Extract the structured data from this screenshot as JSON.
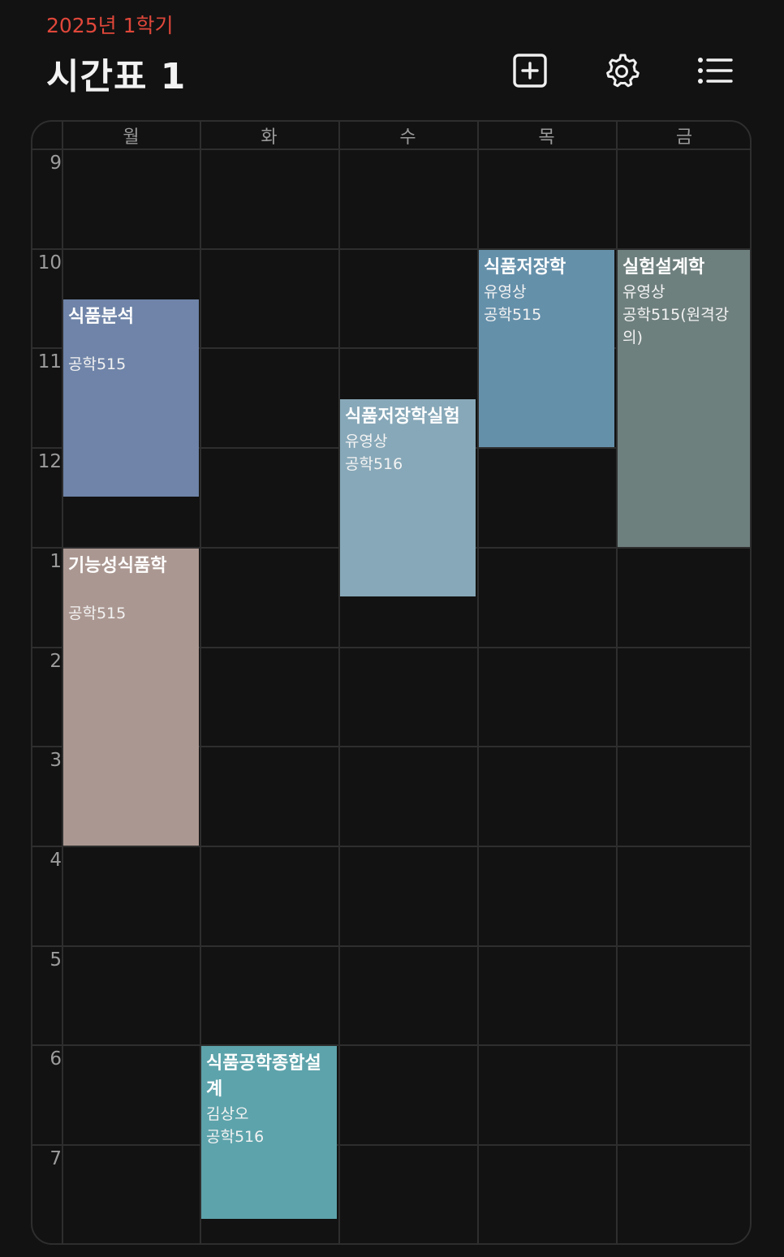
{
  "header": {
    "semester": "2025년 1학기",
    "title": "시간표 1",
    "accent_color": "#e0473a",
    "icons": [
      "add-square-icon",
      "gear-icon",
      "list-icon"
    ]
  },
  "days": [
    "월",
    "화",
    "수",
    "목",
    "금"
  ],
  "hours": [
    "9",
    "10",
    "11",
    "12",
    "1",
    "2",
    "3",
    "4",
    "5",
    "6",
    "7"
  ],
  "courses": [
    {
      "name": "식품분석",
      "professor": "",
      "room": "공학515",
      "day": "월",
      "start": "10:30",
      "end": "12:30",
      "color": "#6f84a8"
    },
    {
      "name": "기능성식품학",
      "professor": "",
      "room": "공학515",
      "day": "월",
      "start": "13:00",
      "end": "16:00",
      "color": "#ab9791"
    },
    {
      "name": "식품공학종합설계",
      "professor": "김상오",
      "room": "공학516",
      "day": "화",
      "start": "18:00",
      "end": "19:45",
      "color": "#5da3ab"
    },
    {
      "name": "식품저장학실험",
      "professor": "유영상",
      "room": "공학516",
      "day": "수",
      "start": "11:30",
      "end": "13:30",
      "color": "#87a8b8"
    },
    {
      "name": "식품저장학",
      "professor": "유영상",
      "room": "공학515",
      "day": "목",
      "start": "10:00",
      "end": "12:00",
      "color": "#6590aa"
    },
    {
      "name": "실험설계학",
      "professor": "유영상",
      "room": "공학515(원격강의)",
      "day": "금",
      "start": "10:00",
      "end": "13:00",
      "color": "#6e807e"
    }
  ]
}
